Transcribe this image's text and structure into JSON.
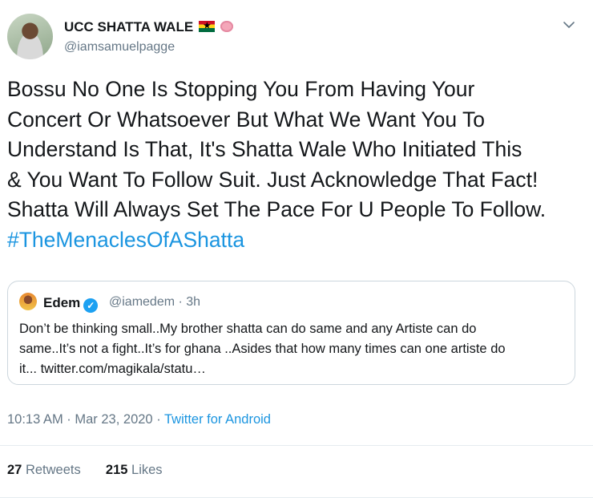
{
  "author": {
    "name": "UCC SHATTA WALE",
    "handle": "@iamsamuelpagge",
    "name_icons": [
      "ghana-flag-icon",
      "brain-icon"
    ]
  },
  "tweet": {
    "lines": [
      "Bossu No One Is Stopping You From Having Your",
      "Concert Or Whatsoever But What We Want You To",
      "Understand Is That, It's Shatta Wale Who Initiated This",
      "& You Want To Follow Suit. Just Acknowledge That Fact!",
      "Shatta Will Always Set The Pace For U People To Follow."
    ],
    "hashtag": "#TheMenaclesOfAShatta"
  },
  "quoted": {
    "name": "Edem",
    "verified_icon": "✓",
    "handle_time": "@iamedem · 3h",
    "lines": [
      "Don’t be thinking small..My brother shatta can do same and any Artiste can do",
      "same..It’s not a fight..It’s for ghana ..Asides that how many times can one artiste do",
      "it... twitter.com/magikala/statu…"
    ]
  },
  "meta": {
    "time_date": "10:13 AM · Mar 23, 2020 · ",
    "source": "Twitter for Android"
  },
  "stats": {
    "retweets_count": "27",
    "retweets_label": " Retweets",
    "likes_count": "215",
    "likes_label": " Likes"
  },
  "colors": {
    "link": "#1b95e0",
    "muted": "#657786",
    "text": "#14171a",
    "border": "#ccd6dd"
  }
}
